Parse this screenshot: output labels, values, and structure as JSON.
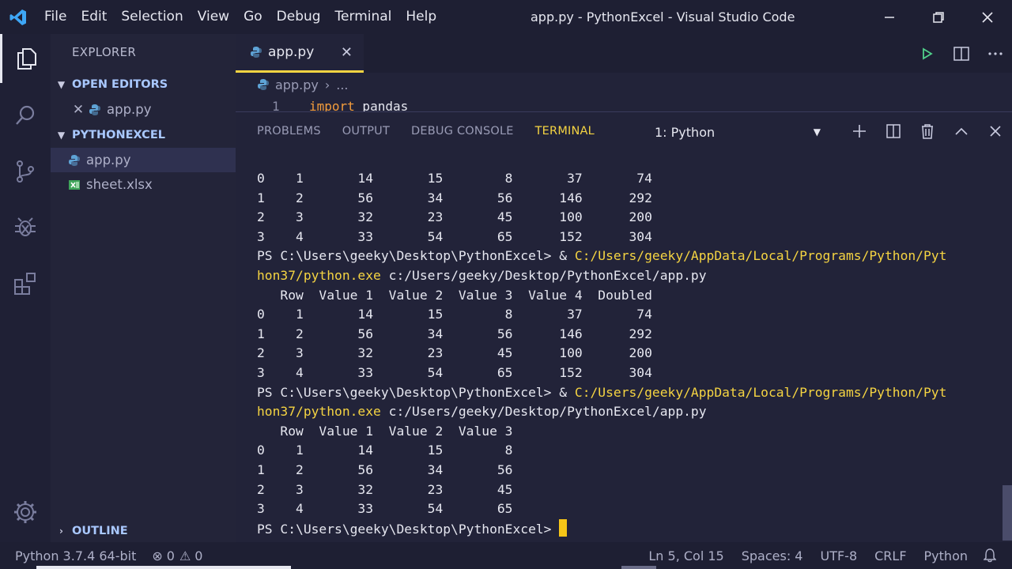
{
  "menu": [
    "File",
    "Edit",
    "Selection",
    "View",
    "Go",
    "Debug",
    "Terminal",
    "Help"
  ],
  "window_title": "app.py - PythonExcel - Visual Studio Code",
  "sidebar": {
    "title": "EXPLORER",
    "open_editors_label": "OPEN EDITORS",
    "open_editors": [
      {
        "name": "app.py"
      }
    ],
    "project_label": "PYTHONEXCEL",
    "files": [
      {
        "name": "app.py"
      },
      {
        "name": "sheet.xlsx"
      }
    ],
    "outline_label": "OUTLINE"
  },
  "editor": {
    "tab_label": "app.py",
    "breadcrumb_file": "app.py",
    "breadcrumb_more": "...",
    "line_number": "1",
    "code_keyword": "import",
    "code_rest": " pandas"
  },
  "panel": {
    "tabs": [
      "PROBLEMS",
      "OUTPUT",
      "DEBUG CONSOLE",
      "TERMINAL"
    ],
    "active_tab": "TERMINAL",
    "terminal_selected": "1: Python"
  },
  "terminal": {
    "lines": [
      {
        "text": "0    1       14       15        8       37       74"
      },
      {
        "text": "1    2       56       34       56      146      292"
      },
      {
        "text": "2    3       32       23       45      100      200"
      },
      {
        "text": "3    4       33       54       65      152      304"
      },
      {
        "prompt": "PS C:\\Users\\geeky\\Desktop\\PythonExcel> & ",
        "path": "C:/Users/geeky/AppData/Local/Programs/Python/Pyt"
      },
      {
        "path": "hon37/python.exe",
        "rest": " c:/Users/geeky/Desktop/PythonExcel/app.py"
      },
      {
        "text": "   Row  Value 1  Value 2  Value 3  Value 4  Doubled"
      },
      {
        "text": "0    1       14       15        8       37       74"
      },
      {
        "text": "1    2       56       34       56      146      292"
      },
      {
        "text": "2    3       32       23       45      100      200"
      },
      {
        "text": "3    4       33       54       65      152      304"
      },
      {
        "prompt": "PS C:\\Users\\geeky\\Desktop\\PythonExcel> & ",
        "path": "C:/Users/geeky/AppData/Local/Programs/Python/Pyt"
      },
      {
        "path": "hon37/python.exe",
        "rest": " c:/Users/geeky/Desktop/PythonExcel/app.py"
      },
      {
        "text": "   Row  Value 1  Value 2  Value 3"
      },
      {
        "text": "0    1       14       15        8"
      },
      {
        "text": "1    2       56       34       56"
      },
      {
        "text": "2    3       32       23       45"
      },
      {
        "text": "3    4       33       54       65"
      }
    ],
    "final_prompt": "PS C:\\Users\\geeky\\Desktop\\PythonExcel> "
  },
  "status": {
    "interpreter": "Python 3.7.4 64-bit",
    "errors": "0",
    "warnings": "0",
    "position": "Ln 5, Col 15",
    "indent": "Spaces: 4",
    "encoding": "UTF-8",
    "eol": "CRLF",
    "language": "Python"
  },
  "colors": {
    "accent_yellow": "#f5d442",
    "background": "#222339",
    "section_blue": "#a9c8ff"
  }
}
